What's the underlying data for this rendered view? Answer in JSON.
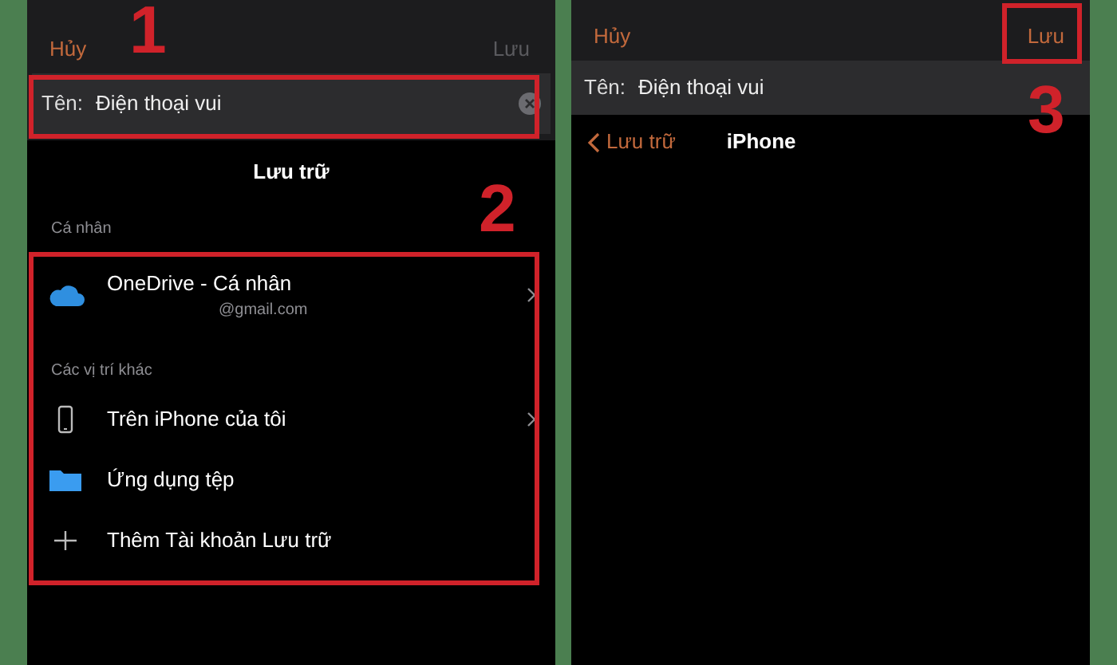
{
  "screens": [
    {
      "top_bar": {
        "cancel": "Hủy",
        "save": {
          "label": "Lưu",
          "disabled": true
        }
      },
      "name_field": {
        "label": "Tên:",
        "value": "Điện thoại vui",
        "clearable": true
      },
      "title": "Lưu trữ",
      "sections": [
        {
          "header": "Cá nhân",
          "items": [
            {
              "kind": "cloud",
              "label": "OneDrive - Cá nhân",
              "subtitle": "@gmail.com",
              "chevron": true
            }
          ]
        },
        {
          "header": "Các vị trí khác",
          "items": [
            {
              "kind": "phone",
              "label": "Trên iPhone của tôi",
              "chevron": true
            },
            {
              "kind": "folder",
              "label": "Ứng dụng tệp",
              "chevron": false
            },
            {
              "kind": "add",
              "label": "Thêm Tài khoản Lưu trữ",
              "chevron": false
            }
          ]
        }
      ],
      "annotations": [
        {
          "kind": "name",
          "number": "1"
        },
        {
          "kind": "list",
          "number": "2"
        }
      ]
    },
    {
      "top_bar": {
        "cancel": "Hủy",
        "save": {
          "label": "Lưu",
          "disabled": false
        }
      },
      "name_field": {
        "label": "Tên:",
        "value": "Điện thoại vui",
        "clearable": false
      },
      "nav": {
        "back": "Lưu trữ",
        "title": "iPhone"
      },
      "annotations": [
        {
          "kind": "save",
          "number": "3"
        }
      ]
    }
  ]
}
